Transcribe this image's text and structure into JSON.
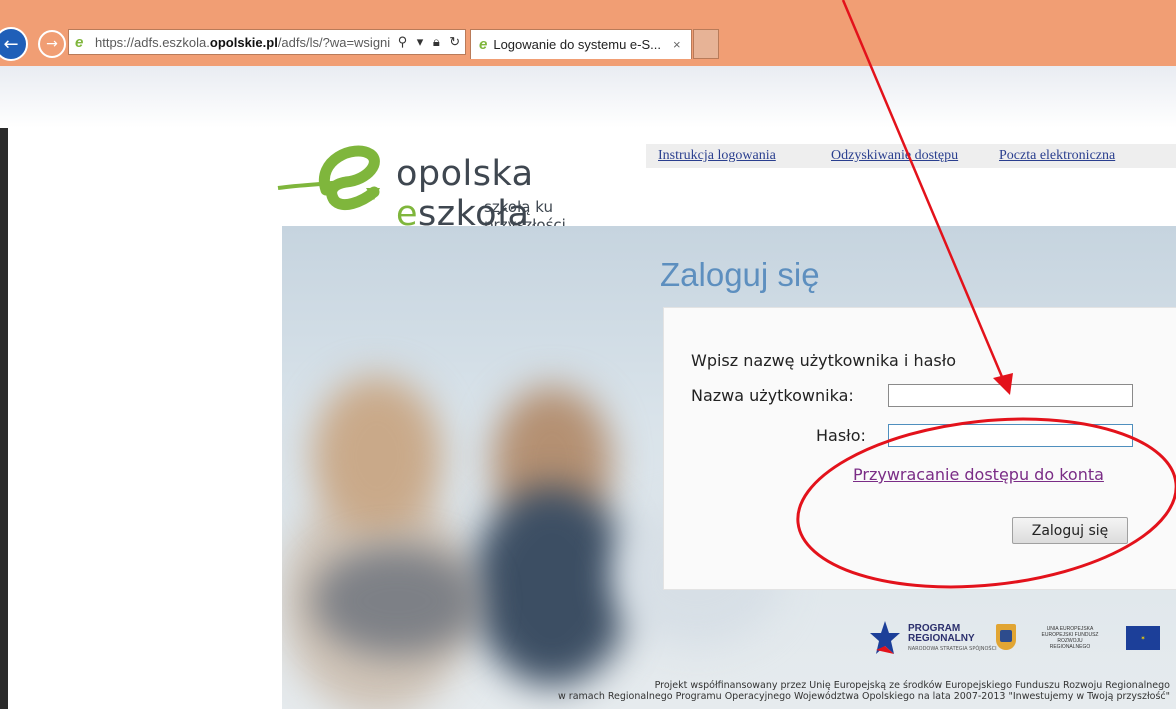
{
  "browser": {
    "address_url_prefix": "https://adfs.eszkola.",
    "address_url_domain": "opolskie.pl",
    "address_url_suffix": "/adfs/ls/?wa=wsigni",
    "tab_title": "Logowanie do systemu e-S...",
    "tab_close": "×",
    "icons": [
      "back-icon",
      "forward-icon",
      "search-icon",
      "dropdown-icon",
      "lock-icon",
      "refresh-icon",
      "close-icon"
    ]
  },
  "brand": {
    "name_part1": "opolska ",
    "name_accent": "e",
    "name_part2": "szkoła",
    "tagline": "szkołą ku przyszłości"
  },
  "topnav": {
    "link1": "Instrukcja logowania",
    "link2": "Odzyskiwanie dostępu",
    "link3": "Poczta elektroniczna"
  },
  "login": {
    "title": "Zaloguj się",
    "heading": "Wpisz nazwę użytkownika i hasło",
    "username_label": "Nazwa użytkownika:",
    "password_label": "Hasło:",
    "username_value": "",
    "password_value": "",
    "recover_link": "Przywracanie dostępu do konta",
    "submit_label": "Zaloguj się"
  },
  "logos": {
    "program_line1": "PROGRAM",
    "program_line2": "REGIONALNY",
    "program_sub": "NARODOWA STRATEGIA SPÓJNOŚCI",
    "eu_text": "UNIA EUROPEJSKA EUROPEJSKI FUNDUSZ ROZWOJU REGIONALNEGO"
  },
  "footer": {
    "line1": "Projekt współfinansowany przez Unię Europejską ze środków Europejskiego Funduszu Rozwoju Regionalnego",
    "line2": "w ramach Regionalnego Programu Operacyjnego Województwa Opolskiego na lata 2007-2013 \"Inwestujemy w Twoją przyszłość\""
  },
  "colors": {
    "chrome": "#f19e74",
    "link": "#2a3f8f",
    "visited_link": "#7a2c86",
    "title": "#5d8fbf",
    "brand_green": "#7fb63c",
    "annotation_red": "#e3121b"
  }
}
